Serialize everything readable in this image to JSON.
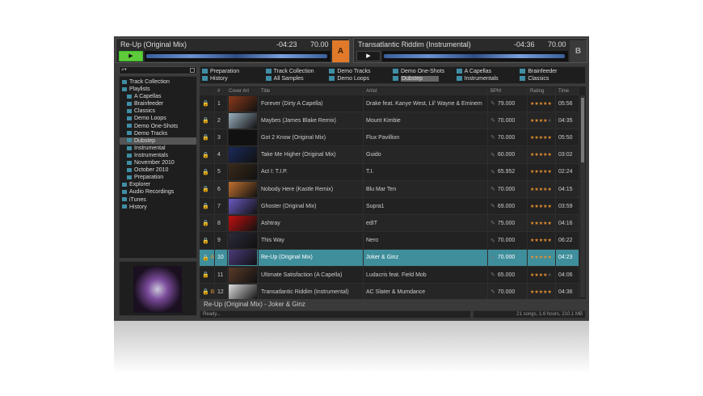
{
  "deckA": {
    "title": "Re-Up (Original Mix)",
    "time": "-04:23",
    "bpm": "70.00",
    "letter": "A",
    "play": "▶"
  },
  "deckB": {
    "title": "Transatlantic Riddim (Instrumental)",
    "time": "-04:36",
    "bpm": "70.00",
    "letter": "B",
    "play": "▶"
  },
  "search": {
    "icon": "⌕▾"
  },
  "tree": [
    {
      "label": "Track Collection",
      "level": 0
    },
    {
      "label": "Playlists",
      "level": 0
    },
    {
      "label": "A Capellas",
      "level": 1
    },
    {
      "label": "Brainfeeder",
      "level": 1
    },
    {
      "label": "Classics",
      "level": 1
    },
    {
      "label": "Demo Loops",
      "level": 1
    },
    {
      "label": "Demo One-Shots",
      "level": 1
    },
    {
      "label": "Demo Tracks",
      "level": 1
    },
    {
      "label": "Dubstep",
      "level": 1,
      "selected": true
    },
    {
      "label": "Instrumental",
      "level": 1
    },
    {
      "label": "Instrumentals",
      "level": 1
    },
    {
      "label": "November 2010",
      "level": 1
    },
    {
      "label": "October 2010",
      "level": 1
    },
    {
      "label": "Preparation",
      "level": 1
    },
    {
      "label": "Explorer",
      "level": 0
    },
    {
      "label": "Audio Recordings",
      "level": 0
    },
    {
      "label": "iTunes",
      "level": 0
    },
    {
      "label": "History",
      "level": 0
    }
  ],
  "favorites": [
    "Preparation",
    "Track Collection",
    "Demo Tracks",
    "Demo One-Shots",
    "A Capellas",
    "Brainfeeder",
    "History",
    "All Samples",
    "Demo Loops",
    "Dubstep",
    "Instrumentals",
    "Classics"
  ],
  "columns": [
    "#",
    "Cover Art",
    "Title",
    "Artist",
    "BPM",
    "Rating",
    "Time"
  ],
  "tracks": [
    {
      "n": "1",
      "title": "Forever (Dirty A Capella)",
      "artist": "Drake feat. Kanye West, Lil' Wayne & Eminem",
      "bpm": "79.000",
      "rating": 5,
      "time": "05:56",
      "deck": "",
      "cover": "#8a3a1a"
    },
    {
      "n": "2",
      "title": "Maybes (James Blake Remix)",
      "artist": "Mount Kimbie",
      "bpm": "70.000",
      "rating": 4,
      "time": "04:35",
      "deck": "",
      "cover": "#9ab0c0"
    },
    {
      "n": "3",
      "title": "Got 2 Know (Original Mix)",
      "artist": "Flux Pavillion",
      "bpm": "70.000",
      "rating": 5,
      "time": "05:50",
      "deck": "",
      "cover": "#111"
    },
    {
      "n": "4",
      "title": "Take Me Higher (Original Mix)",
      "artist": "Guido",
      "bpm": "60.000",
      "rating": 5,
      "time": "03:02",
      "deck": "",
      "cover": "#1a2a5a"
    },
    {
      "n": "5",
      "title": "Act I: T.I.P.",
      "artist": "T.I.",
      "bpm": "65.952",
      "rating": 5,
      "time": "02:24",
      "deck": "",
      "cover": "#3a2a1a"
    },
    {
      "n": "6",
      "title": "Nobody Here (Kastle Remix)",
      "artist": "Blu Mar Ten",
      "bpm": "70.000",
      "rating": 5,
      "time": "04:15",
      "deck": "",
      "cover": "#c07030"
    },
    {
      "n": "7",
      "title": "Ghoster (Original Mix)",
      "artist": "Supra1",
      "bpm": "69.000",
      "rating": 5,
      "time": "03:59",
      "deck": "",
      "cover": "#6a5ac0"
    },
    {
      "n": "8",
      "title": "Ashtray",
      "artist": "edIT",
      "bpm": "75.000",
      "rating": 5,
      "time": "04:16",
      "deck": "",
      "cover": "#c01010"
    },
    {
      "n": "9",
      "title": "This Way",
      "artist": "Nero",
      "bpm": "70.000",
      "rating": 5,
      "time": "06:22",
      "deck": "",
      "cover": "#2a2a3a"
    },
    {
      "n": "10",
      "title": "Re-Up (Original Mix)",
      "artist": "Joker & Ginz",
      "bpm": "70.000",
      "rating": 5,
      "time": "04:23",
      "deck": "A",
      "cover": "#4a3a7a",
      "selected": true
    },
    {
      "n": "11",
      "title": "Ultimate Satisfaction (A Capella)",
      "artist": "Ludacris feat. Field Mob",
      "bpm": "65.000",
      "rating": 4,
      "time": "04:06",
      "deck": "",
      "cover": "#5a3a2a"
    },
    {
      "n": "12",
      "title": "Transatlantic Riddim (Instrumental)",
      "artist": "AC Slater & Mumdance",
      "bpm": "70.000",
      "rating": 5,
      "time": "04:36",
      "deck": "B",
      "cover": "#ddd"
    }
  ],
  "now_playing": "Re-Up (Original Mix) - Joker & Ginz",
  "status": {
    "left": "Ready...",
    "right": "21 songs, 1.6 hours, 210.1 MB"
  },
  "colors": {
    "deckA": "#e07a2a",
    "deckB": "#3a3a3a",
    "selection": "#3f8e9b",
    "star": "#e89030"
  }
}
